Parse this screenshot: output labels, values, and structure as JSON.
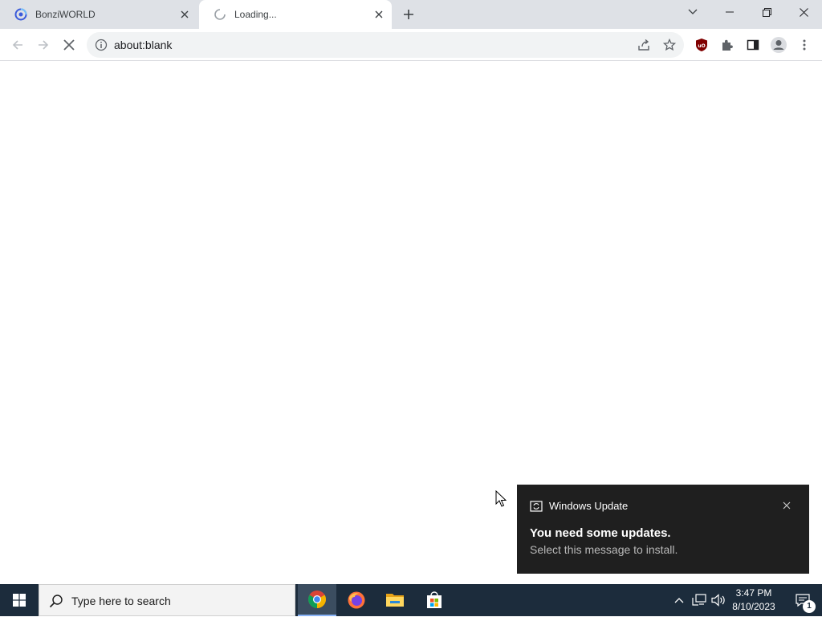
{
  "browser": {
    "tabs": [
      {
        "title": "BonziWORLD",
        "favicon": "bonziworld-favicon-icon",
        "active": false
      },
      {
        "title": "Loading...",
        "favicon": "loading-spinner-icon",
        "active": true
      }
    ],
    "address": "about:blank"
  },
  "toast": {
    "app": "Windows Update",
    "title": "You need some updates.",
    "body": "Select this message to install."
  },
  "taskbar": {
    "search_placeholder": "Type here to search",
    "time": "3:47 PM",
    "date": "8/10/2023",
    "notification_count": "1"
  },
  "colors": {
    "tabstrip": "#dee1e6",
    "taskbar": "#1c2c3c",
    "toast": "#1f1f1f",
    "ublock_red": "#800000"
  }
}
